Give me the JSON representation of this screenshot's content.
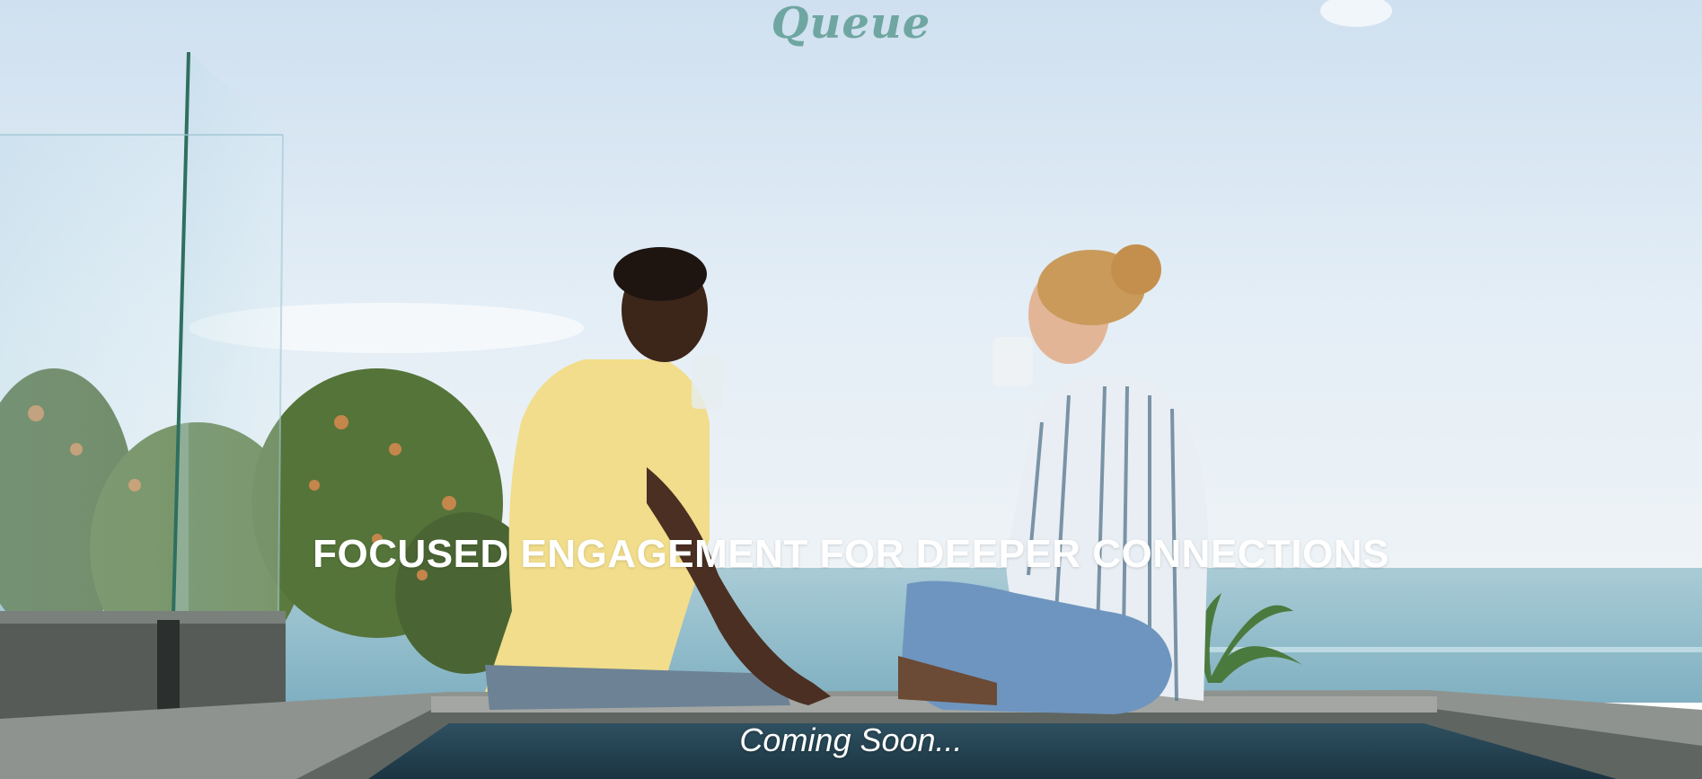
{
  "logo": {
    "text": "Queue",
    "heart_icon": "heart-icon"
  },
  "hero": {
    "tagline": "FOCUSED ENGAGEMENT FOR DEEPER CONNECTIONS",
    "status": "Coming Soon..."
  },
  "colors": {
    "brand": "#6fa6a1",
    "heart": "#e84a5f",
    "sky": "#d9e7f3",
    "sea": "#8fb9c8",
    "text": "#ffffff"
  }
}
